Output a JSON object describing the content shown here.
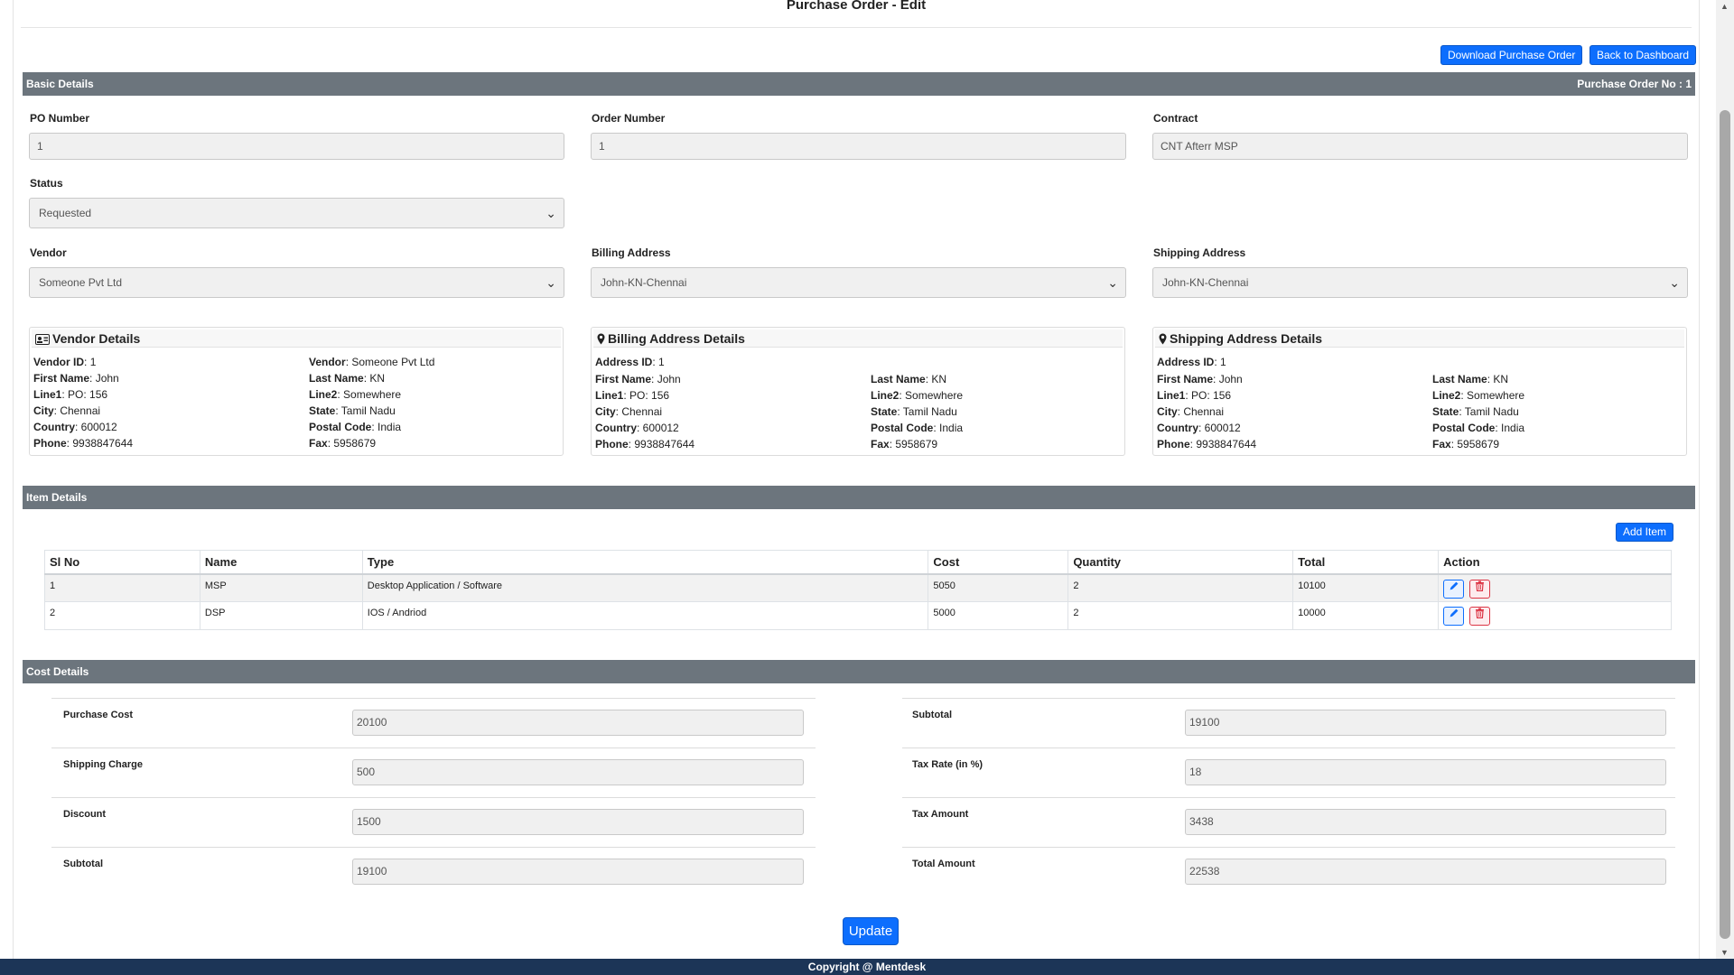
{
  "page": {
    "title": "Purchase Order - Edit"
  },
  "actions": {
    "download_label": "Download Purchase Order",
    "back_label": "Back to Dashboard"
  },
  "basic": {
    "section_title": "Basic Details",
    "po_no_text": "Purchase Order No : 1",
    "po_number": {
      "label": "PO Number",
      "value": "1"
    },
    "order_number": {
      "label": "Order Number",
      "value": "1"
    },
    "contract": {
      "label": "Contract",
      "value": "CNT Afterr MSP"
    },
    "status": {
      "label": "Status",
      "value": "Requested"
    },
    "vendor": {
      "label": "Vendor",
      "value": "Someone Pvt Ltd"
    },
    "billing": {
      "label": "Billing Address",
      "value": "John-KN-Chennai"
    },
    "shipping": {
      "label": "Shipping Address",
      "value": "John-KN-Chennai"
    }
  },
  "vendor_card": {
    "title": "Vendor Details",
    "fields": [
      {
        "k": "Vendor ID",
        "v": "1"
      },
      {
        "k": "Vendor",
        "v": "Someone Pvt Ltd"
      },
      {
        "k": "First Name",
        "v": "John"
      },
      {
        "k": "Last Name",
        "v": "KN"
      },
      {
        "k": "Line1",
        "v": "PO: 156"
      },
      {
        "k": "Line2",
        "v": "Somewhere"
      },
      {
        "k": "City",
        "v": "Chennai"
      },
      {
        "k": "State",
        "v": "Tamil Nadu"
      },
      {
        "k": "Country",
        "v": "600012"
      },
      {
        "k": "Postal Code",
        "v": "India"
      },
      {
        "k": "Phone",
        "v": "9938847644"
      },
      {
        "k": "Fax",
        "v": "5958679"
      }
    ]
  },
  "billing_card": {
    "title": "Billing Address Details",
    "fields": [
      {
        "k": "Address ID",
        "v": "1"
      },
      {
        "k": "First Name",
        "v": "John"
      },
      {
        "k": "Last Name",
        "v": "KN"
      },
      {
        "k": "Line1",
        "v": "PO: 156"
      },
      {
        "k": "Line2",
        "v": "Somewhere"
      },
      {
        "k": "City",
        "v": "Chennai"
      },
      {
        "k": "State",
        "v": "Tamil Nadu"
      },
      {
        "k": "Country",
        "v": "600012"
      },
      {
        "k": "Postal Code",
        "v": "India"
      },
      {
        "k": "Phone",
        "v": "9938847644"
      },
      {
        "k": "Fax",
        "v": "5958679"
      }
    ]
  },
  "shipping_card": {
    "title": "Shipping Address Details",
    "fields": [
      {
        "k": "Address ID",
        "v": "1"
      },
      {
        "k": "First Name",
        "v": "John"
      },
      {
        "k": "Last Name",
        "v": "KN"
      },
      {
        "k": "Line1",
        "v": "PO: 156"
      },
      {
        "k": "Line2",
        "v": "Somewhere"
      },
      {
        "k": "City",
        "v": "Chennai"
      },
      {
        "k": "State",
        "v": "Tamil Nadu"
      },
      {
        "k": "Country",
        "v": "600012"
      },
      {
        "k": "Postal Code",
        "v": "India"
      },
      {
        "k": "Phone",
        "v": "9938847644"
      },
      {
        "k": "Fax",
        "v": "5958679"
      }
    ]
  },
  "items": {
    "section_title": "Item Details",
    "add_label": "Add Item",
    "headers": [
      "Sl No",
      "Name",
      "Type",
      "Cost",
      "Quantity",
      "Total",
      "Action"
    ],
    "rows": [
      {
        "sl": "1",
        "name": "MSP",
        "type": "Desktop Application / Software",
        "cost": "5050",
        "qty": "2",
        "total": "10100"
      },
      {
        "sl": "2",
        "name": "DSP",
        "type": "IOS / Andriod",
        "cost": "5000",
        "qty": "2",
        "total": "10000"
      }
    ]
  },
  "cost": {
    "section_title": "Cost Details",
    "left": [
      {
        "label": "Purchase Cost",
        "value": "20100"
      },
      {
        "label": "Shipping Charge",
        "value": "500"
      },
      {
        "label": "Discount",
        "value": "1500"
      },
      {
        "label": "Subtotal",
        "value": "19100"
      }
    ],
    "right": [
      {
        "label": "Subtotal",
        "value": "19100"
      },
      {
        "label": "Tax Rate (in %)",
        "value": "18"
      },
      {
        "label": "Tax Amount",
        "value": "3438"
      },
      {
        "label": "Total Amount",
        "value": "22538"
      }
    ]
  },
  "update_label": "Update",
  "footer": {
    "text": "Copyright @ Mentdesk"
  },
  "icons": {
    "vendor": "id-card-icon",
    "billing": "map-marker-icon",
    "shipping": "map-marker-icon",
    "edit": "pencil-icon",
    "delete": "trash-icon"
  },
  "colors": {
    "primary": "#0d6efd",
    "section_bar": "#6c757d",
    "footer": "#1c3557",
    "danger": "#dc3545"
  }
}
